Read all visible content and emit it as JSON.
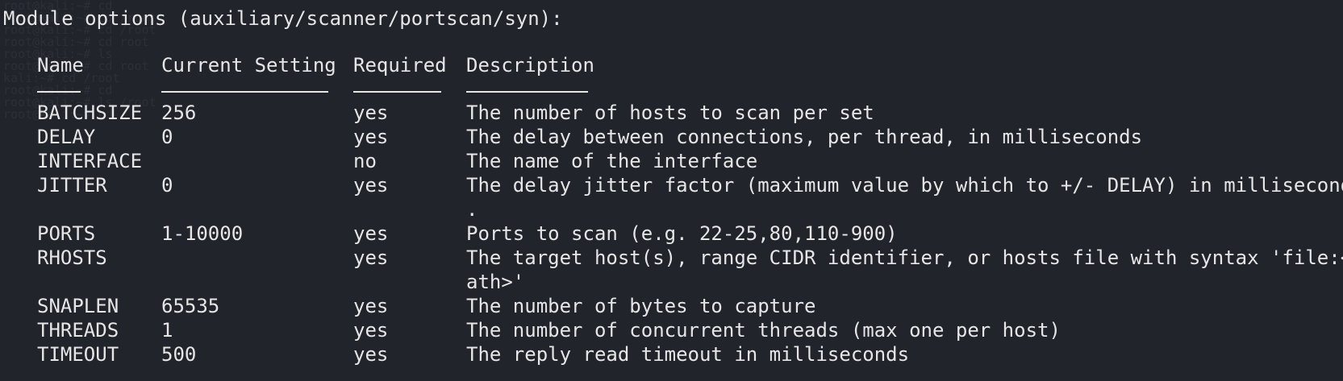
{
  "heading": "Module options (auxiliary/scanner/portscan/syn):",
  "columns": {
    "name": "Name",
    "current_setting": "Current Setting",
    "required": "Required",
    "description": "Description"
  },
  "rows": [
    {
      "name": "BATCHSIZE",
      "setting": "256",
      "required": "yes",
      "description": "The number of hosts to scan per set",
      "description_cont": ""
    },
    {
      "name": "DELAY",
      "setting": "0",
      "required": "yes",
      "description": "The delay between connections, per thread, in milliseconds",
      "description_cont": ""
    },
    {
      "name": "INTERFACE",
      "setting": "",
      "required": "no",
      "description": "The name of the interface",
      "description_cont": ""
    },
    {
      "name": "JITTER",
      "setting": "0",
      "required": "yes",
      "description": "The delay jitter factor (maximum value by which to +/- DELAY) in milliseconds",
      "description_cont": "."
    },
    {
      "name": "PORTS",
      "setting": "1-10000",
      "required": "yes",
      "description": "Ports to scan (e.g. 22-25,80,110-900)",
      "description_cont": ""
    },
    {
      "name": "RHOSTS",
      "setting": "",
      "required": "yes",
      "description": "The target host(s), range CIDR identifier, or hosts file with syntax 'file:<p",
      "description_cont": "ath>'"
    },
    {
      "name": "SNAPLEN",
      "setting": "65535",
      "required": "yes",
      "description": "The number of bytes to capture",
      "description_cont": ""
    },
    {
      "name": "THREADS",
      "setting": "1",
      "required": "yes",
      "description": "The number of concurrent threads (max one per host)",
      "description_cont": ""
    },
    {
      "name": "TIMEOUT",
      "setting": "500",
      "required": "yes",
      "description": "The reply read timeout in milliseconds",
      "description_cont": ""
    }
  ],
  "colors": {
    "background": "#22242c",
    "foreground": "#e6e6e6"
  }
}
